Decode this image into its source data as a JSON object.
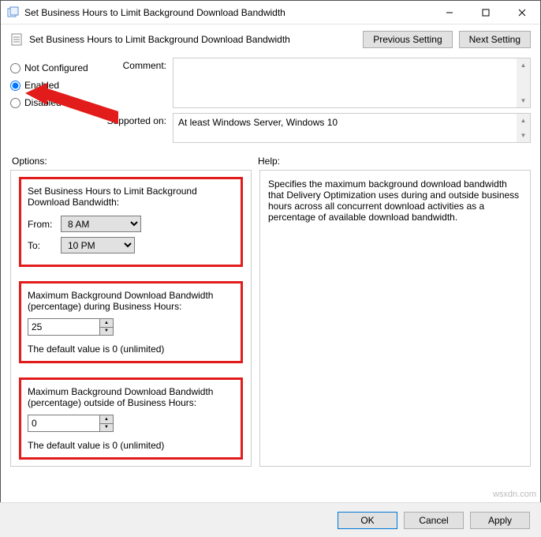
{
  "window": {
    "title": "Set Business Hours to Limit Background Download Bandwidth"
  },
  "header": {
    "title": "Set Business Hours to Limit Background Download Bandwidth",
    "prev_btn": "Previous Setting",
    "next_btn": "Next Setting"
  },
  "radios": {
    "not_configured": "Not Configured",
    "enabled": "Enabled",
    "disabled": "Disabled",
    "selected": "enabled"
  },
  "meta": {
    "comment_label": "Comment:",
    "comment_value": "",
    "supported_label": "Supported on:",
    "supported_value": "At least Windows Server, Windows 10"
  },
  "sections": {
    "options_label": "Options:",
    "help_label": "Help:"
  },
  "options": {
    "heading": "Set Business Hours to Limit Background Download Bandwidth:",
    "from_label": "From:",
    "from_value": "8 AM",
    "to_label": "To:",
    "to_value": "10 PM",
    "during_label": "Maximum Background Download Bandwidth (percentage) during Business Hours:",
    "during_value": "25",
    "during_default": "The default value is 0 (unlimited)",
    "outside_label": "Maximum Background Download Bandwidth (percentage) outside of Business Hours:",
    "outside_value": "0",
    "outside_default": "The default value is 0 (unlimited)"
  },
  "help_text": "Specifies the maximum background download bandwidth that Delivery Optimization uses during and outside business hours across all concurrent download activities as a percentage of available download bandwidth.",
  "footer": {
    "ok": "OK",
    "cancel": "Cancel",
    "apply": "Apply"
  },
  "watermark": "wsxdn.com"
}
